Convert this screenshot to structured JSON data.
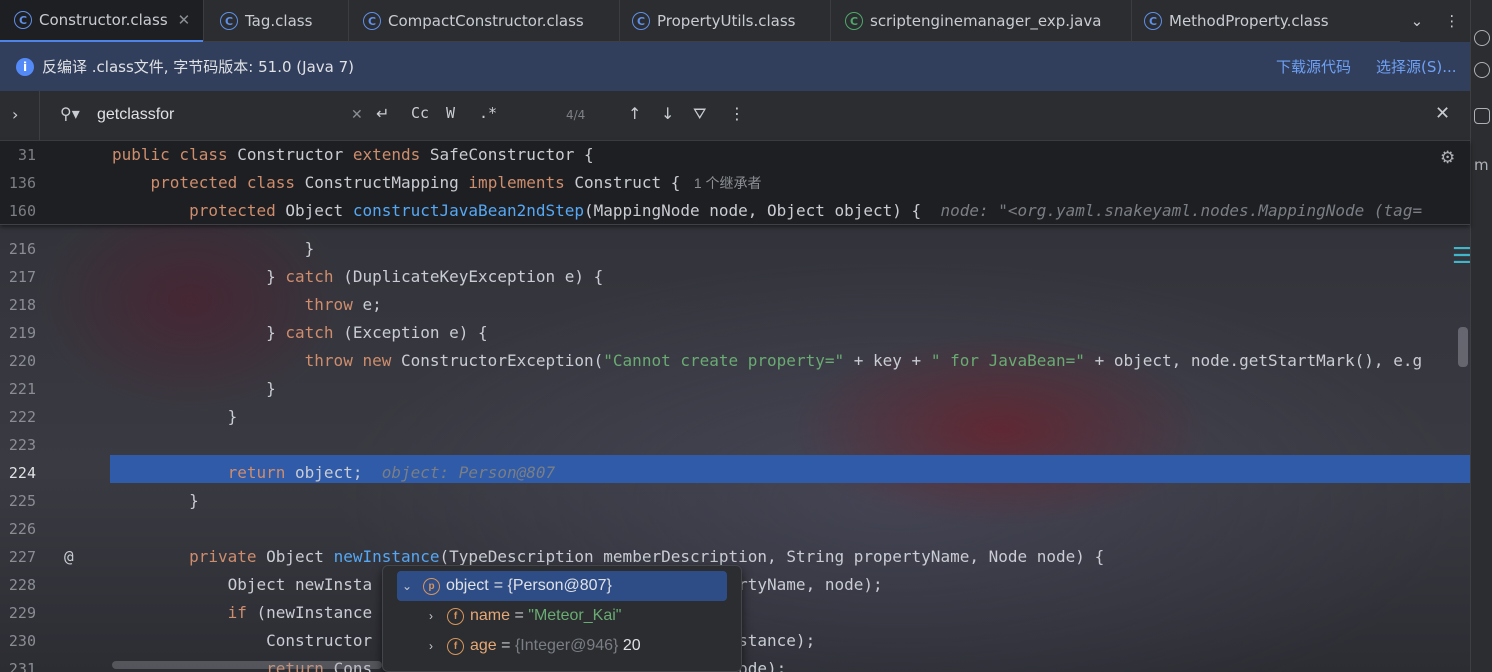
{
  "tabs": [
    {
      "label": "Constructor.class",
      "icon": "class-icon",
      "active": true
    },
    {
      "label": "Tag.class",
      "icon": "class-icon"
    },
    {
      "label": "CompactConstructor.class",
      "icon": "class-icon"
    },
    {
      "label": "PropertyUtils.class",
      "icon": "class-icon"
    },
    {
      "label": "scriptenginemanager_exp.java",
      "icon": "java-file-icon"
    },
    {
      "label": "MethodProperty.class",
      "icon": "class-icon"
    }
  ],
  "banner": {
    "text": "反编译 .class文件, 字节码版本: 51.0 (Java 7)",
    "download_link": "下载源代码",
    "choose_link": "选择源(S)..."
  },
  "search": {
    "value": "getclassfor",
    "match_count": "4/4",
    "opt_case": "Cc",
    "opt_word": "W",
    "opt_regex": ".*"
  },
  "sticky": [
    {
      "num": "31",
      "indent": "",
      "tokens": [
        [
          "kw",
          "public class "
        ],
        [
          "plain",
          "Constructor "
        ],
        [
          "kw",
          "extends "
        ],
        [
          "plain",
          "SafeConstructor {"
        ]
      ]
    },
    {
      "num": "136",
      "indent": "    ",
      "tokens": [
        [
          "kw",
          "protected class "
        ],
        [
          "plain",
          "ConstructMapping "
        ],
        [
          "kw",
          "implements "
        ],
        [
          "plain",
          "Construct { "
        ],
        [
          "muted",
          " 1 个继承者"
        ]
      ]
    },
    {
      "num": "160",
      "indent": "        ",
      "tokens": [
        [
          "kw",
          "protected "
        ],
        [
          "plain",
          "Object "
        ],
        [
          "fn",
          "constructJavaBean2ndStep"
        ],
        [
          "plain",
          "(MappingNode node, Object object) {  "
        ],
        [
          "hint",
          "node: \"<org.yaml.snakeyaml.nodes.MappingNode (tag="
        ]
      ]
    }
  ],
  "code": [
    {
      "num": "216",
      "indent": "                    ",
      "tokens": [
        [
          "plain",
          "}"
        ]
      ]
    },
    {
      "num": "217",
      "indent": "                ",
      "tokens": [
        [
          "plain",
          "} "
        ],
        [
          "kw",
          "catch "
        ],
        [
          "plain",
          "(DuplicateKeyException e) {"
        ]
      ]
    },
    {
      "num": "218",
      "indent": "                    ",
      "tokens": [
        [
          "kw",
          "throw "
        ],
        [
          "plain",
          "e;"
        ]
      ]
    },
    {
      "num": "219",
      "indent": "                ",
      "tokens": [
        [
          "plain",
          "} "
        ],
        [
          "kw",
          "catch "
        ],
        [
          "plain",
          "(Exception e) {"
        ]
      ]
    },
    {
      "num": "220",
      "indent": "                    ",
      "tokens": [
        [
          "kw",
          "throw new "
        ],
        [
          "plain",
          "ConstructorException("
        ],
        [
          "str",
          "\"Cannot create property=\""
        ],
        [
          "plain",
          " + key + "
        ],
        [
          "str",
          "\" for JavaBean=\""
        ],
        [
          "plain",
          " + object, node.getStartMark(), e.g"
        ]
      ]
    },
    {
      "num": "221",
      "indent": "                ",
      "tokens": [
        [
          "plain",
          "}"
        ]
      ]
    },
    {
      "num": "222",
      "indent": "            ",
      "tokens": [
        [
          "plain",
          "}"
        ]
      ]
    },
    {
      "num": "223",
      "indent": "",
      "tokens": []
    },
    {
      "num": "224",
      "indent": "            ",
      "tokens": [
        [
          "kw",
          "return "
        ],
        [
          "plain",
          "object;  "
        ],
        [
          "hint",
          "object: Person@807"
        ]
      ],
      "highlight": true
    },
    {
      "num": "225",
      "indent": "        ",
      "tokens": [
        [
          "plain",
          "}"
        ]
      ]
    },
    {
      "num": "226",
      "indent": "",
      "tokens": []
    },
    {
      "num": "227",
      "indent": "        ",
      "tokens": [
        [
          "kw",
          "private "
        ],
        [
          "plain",
          "Object "
        ],
        [
          "fn",
          "newInstance"
        ],
        [
          "plain",
          "(TypeDescription memberDescription, String propertyName, Node node) {"
        ]
      ],
      "gutter": "@"
    },
    {
      "num": "228",
      "indent": "            ",
      "tokens": [
        [
          "plain",
          "Object newInsta                                 propertyName, node);"
        ]
      ]
    },
    {
      "num": "229",
      "indent": "            ",
      "tokens": [
        [
          "kw",
          "if "
        ],
        [
          "plain",
          "(newInstance"
        ]
      ]
    },
    {
      "num": "230",
      "indent": "                ",
      "tokens": [
        [
          "plain",
          "Constructor                                  ewInstance);"
        ]
      ]
    },
    {
      "num": "231",
      "indent": "                ",
      "tokens": [
        [
          "kw",
          "return "
        ],
        [
          "plain",
          "Cons                                     node);"
        ]
      ]
    }
  ],
  "popup": {
    "root": {
      "name": "object",
      "value": "= {Person@807}"
    },
    "fields": [
      {
        "name": "name",
        "eq": " = ",
        "value": "\"Meteor_Kai\""
      },
      {
        "name": "age",
        "eq": " = ",
        "type": "{Integer@946}",
        "value": " 20"
      }
    ]
  }
}
